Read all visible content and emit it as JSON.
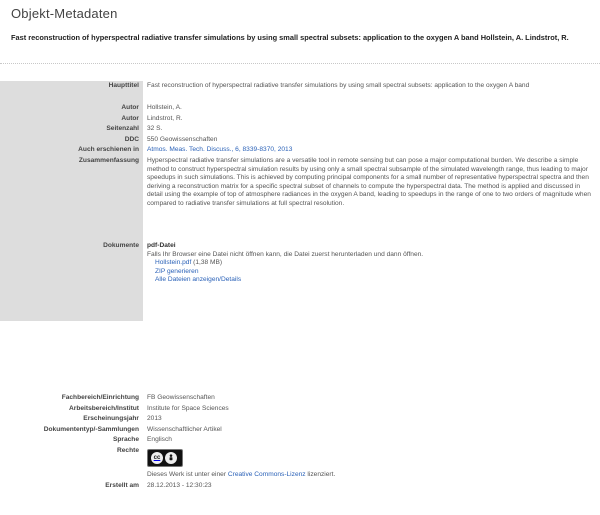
{
  "page": {
    "title": "Objekt-Metadaten",
    "doc_title": "Fast reconstruction of hyperspectral radiative transfer simulations by using small spectral subsets: application to the oxygen A band Hollstein, A. Lindstrot, R."
  },
  "meta": {
    "haupttitel": {
      "label": "Haupttitel",
      "value": "Fast reconstruction of hyperspectral radiative transfer simulations by using small spectral subsets: application to the oxygen A band"
    },
    "autor1": {
      "label": "Autor",
      "value": "Hollstein, A."
    },
    "autor2": {
      "label": "Autor",
      "value": "Lindstrot, R."
    },
    "seitenzahl": {
      "label": "Seitenzahl",
      "value": "32 S."
    },
    "ddc": {
      "label": "DDC",
      "value": "550 Geowissenschaften"
    },
    "erschienen": {
      "label": "Auch erschienen in",
      "value": "Atmos. Meas. Tech. Discuss., 6, 8339-8370, 2013"
    },
    "zusammenfassung": {
      "label": "Zusammenfassung",
      "value": "Hyperspectral radiative transfer simulations are a versatile tool in remote sensing but can pose a major computational burden. We describe a simple method to construct hyperspectral simulation results by using only a small spectral subsample of the simulated wavelength range, thus leading to major speedups in such simulations. This is achieved by computing principal components for a small number of representative hyperspectral spectra and then deriving a reconstruction matrix for a specific spectral subset of channels to compute the hyperspectral data. The method is applied and discussed in detail using the example of top of atmosphere radiances in the oxygen A band, leading to speedups in the range of one to two orders of magnitude when compared to radiative transfer simulations at full spectral resolution."
    },
    "dokumente": {
      "label": "Dokumente",
      "file_type": "pdf-Datei",
      "hint": "Falls Ihr Browser eine Datei nicht öffnen kann, die Datei zuerst herunterladen und dann öffnen.",
      "file_link": "Hollstein.pdf",
      "file_size": "(1,38 MB)",
      "zip_link": "ZIP generieren",
      "all_link": "Alle Dateien anzeigen/Details"
    }
  },
  "meta2": {
    "fachbereich": {
      "label": "Fachbereich/Einrichtung",
      "value": "FB Geowissenschaften"
    },
    "arbeitsbereich": {
      "label": "Arbeitsbereich/Institut",
      "value": "Institute for Space Sciences"
    },
    "erscheinungsjahr": {
      "label": "Erscheinungsjahr",
      "value": "2013"
    },
    "dokumententyp": {
      "label": "Dokumententyp/-Sammlungen",
      "value": "Wissenschaftlicher Artikel"
    },
    "sprache": {
      "label": "Sprache",
      "value": "Englisch"
    },
    "rechte": {
      "label": "Rechte",
      "badge_cc": "cc",
      "text_before": "Dieses Werk ist unter einer",
      "license_link": "Creative Commons-Lizenz",
      "text_after": "lizenziert."
    },
    "erstellt": {
      "label": "Erstellt am",
      "value": "28.12.2013 - 12:30:23"
    }
  },
  "colors": {
    "link": "#2b62b8",
    "label_bg": "#dddddd",
    "badge_bg": "#111111"
  },
  "icons": {
    "cc": "creative-commons-icon",
    "by": "attribution-person-icon"
  }
}
